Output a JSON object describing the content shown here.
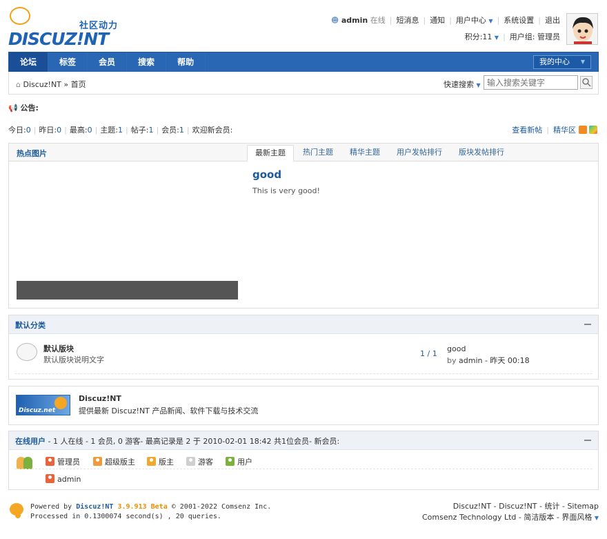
{
  "header": {
    "logo_tagline": "社区动力",
    "logo_word": "DISCUZ!NT",
    "username": "admin",
    "online_status": "在线",
    "links": [
      "短消息",
      "通知",
      "用户中心",
      "系统设置",
      "退出"
    ],
    "credits": "积分:11",
    "usergroup": "用户组: 管理员"
  },
  "nav": {
    "items": [
      "论坛",
      "标签",
      "会员",
      "搜索",
      "帮助"
    ],
    "active": "论坛",
    "my_center": "我的中心"
  },
  "breadcrumb": {
    "site": "Discuz!NT",
    "sep": "»",
    "current": "首页",
    "quick_search": "快速搜索",
    "search_placeholder": "输入搜索关键字"
  },
  "notice": {
    "label": "公告:"
  },
  "stats": {
    "today_label": "今日:",
    "today": "0",
    "yesterday_label": "昨日:",
    "yesterday": "0",
    "max_label": "最高:",
    "max": "0",
    "threads_label": "主题:",
    "threads": "1",
    "posts_label": "帖子:",
    "posts": "1",
    "members_label": "会员:",
    "members": "1",
    "welcome": "欢迎新会员:",
    "new_posts": "查看新帖",
    "digest": "精华区"
  },
  "hot": {
    "title": "热点图片",
    "tabs": [
      "最新主题",
      "热门主题",
      "精华主题",
      "用户发帖排行",
      "版块发帖排行"
    ],
    "post_title": "good",
    "post_text": "This is very good!"
  },
  "category": {
    "title": "默认分类",
    "forum_name": "默认版块",
    "forum_desc": "默认版块说明文字",
    "counts": "1 / 1",
    "last_title": "good",
    "last_by": "by",
    "last_user": "admin",
    "last_time": "- 昨天 00:18"
  },
  "links": {
    "logo_text": "Discuz.net",
    "name": "Discuz!NT",
    "desc": "提供最新 Discuz!NT 产品新闻、软件下载与技术交流"
  },
  "online": {
    "label": "在线用户",
    "summary": "- 1 人在线 - 1 会员, 0 游客- 最高记录是 2 于 2010-02-01 18:42   共1位会员- 新会员:",
    "groups": [
      "管理员",
      "超级版主",
      "版主",
      "游客",
      "用户"
    ],
    "group_colors": [
      "#e8643a",
      "#f09a3c",
      "#f0a830",
      "#cfcfcf",
      "#7bb13c"
    ],
    "user": "admin"
  },
  "footer": {
    "powered": "Powered by",
    "product": "Discuz!NT",
    "version": "3.9.913 Beta",
    "copyright": "© 2001-2022 Comsenz Inc.",
    "processed": "Processed in 0.1300074 second(s) , 20 queries.",
    "right_line1": "Discuz!NT - Discuz!NT - 统计 - Sitemap",
    "right_line2": "Comsenz Technology Ltd - 简洁版本 - 界面风格"
  }
}
